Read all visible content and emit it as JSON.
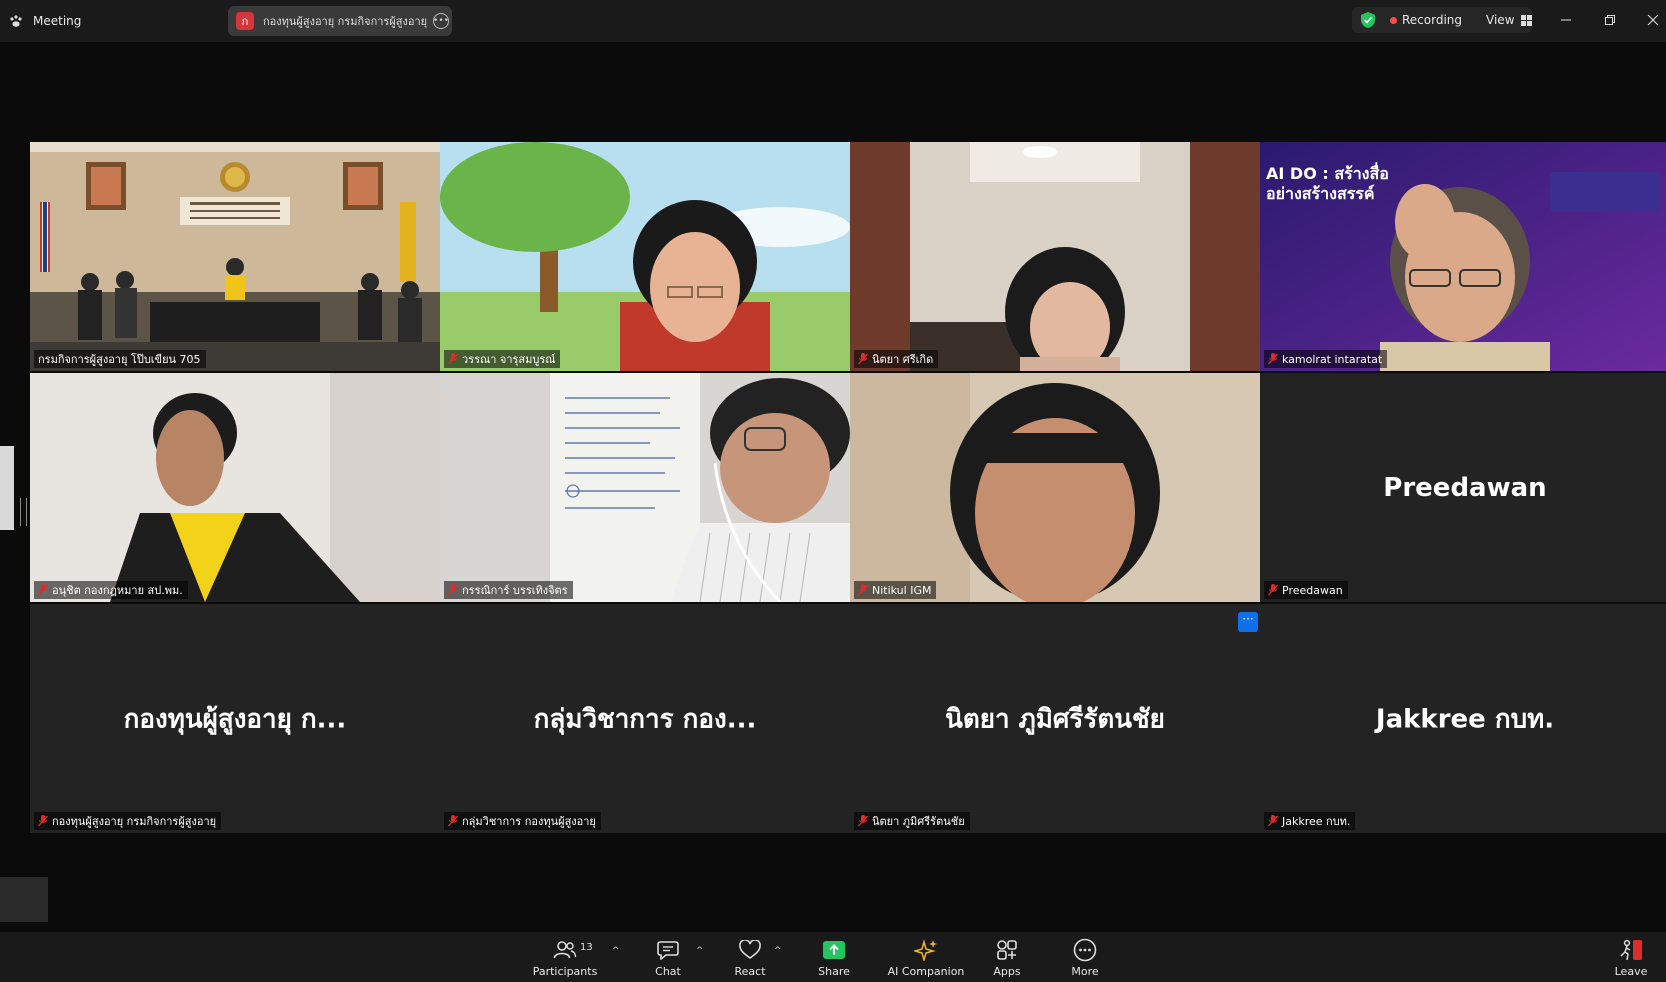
{
  "app": {
    "title": "Meeting",
    "share_pill": {
      "avatar_letter": "ก",
      "text": "กองทุนผู้สูงอายุ กรมกิจการผู้สูงอายุ's sc"
    },
    "status": {
      "recording_label": "Recording",
      "view_label": "View"
    }
  },
  "tiles": [
    {
      "name": "กรมกิจการผู้สูงอายุ โป๊บเขียน 705",
      "big_name": "",
      "muted": false,
      "active": true,
      "scene": "room"
    },
    {
      "name": "วรรณา จารุสมบูรณ์",
      "big_name": "",
      "muted": true,
      "scene": "woman-tree"
    },
    {
      "name": "นิตยา ศรีเกิด",
      "big_name": "",
      "muted": true,
      "scene": "woman-room"
    },
    {
      "name": "kamolrat intaratat",
      "big_name": "",
      "muted": true,
      "scene": "woman-banner",
      "banner": "AI DO : สร้างสื่อ อย่างสร้างสรรค์"
    },
    {
      "name": "อนุชิต กองกฎหมาย สป.พม.",
      "big_name": "",
      "muted": true,
      "scene": "man-yellow"
    },
    {
      "name": "กรรณิการ์ บรรเทิงจิตร",
      "big_name": "",
      "muted": true,
      "scene": "whiteboard"
    },
    {
      "name": "Nitikul IGM",
      "big_name": "",
      "muted": true,
      "scene": "woman-close"
    },
    {
      "name": "Preedawan",
      "big_name": "Preedawan",
      "muted": true
    },
    {
      "name": "กองทุนผู้สูงอายุ กรมกิจการผู้สูงอายุ",
      "big_name": "กองทุนผู้สูงอายุ ก...",
      "muted": true
    },
    {
      "name": "กลุ่มวิชาการ กองทุนผู้สูงอายุ",
      "big_name": "กลุ่มวิชาการ กอง...",
      "muted": true
    },
    {
      "name": "นิตยา ภูมิศรีรัตนชัย",
      "big_name": "นิตยา ภูมิศรีรัตนชัย",
      "muted": true
    },
    {
      "name": "Jakkree กบท.",
      "big_name": "Jakkree กบท.",
      "muted": true
    }
  ],
  "toolbar": {
    "participants_label": "Participants",
    "participants_count": "13",
    "chat_label": "Chat",
    "react_label": "React",
    "share_label": "Share",
    "ai_label": "AI Companion",
    "apps_label": "Apps",
    "more_label": "More",
    "leave_label": "Leave"
  },
  "colors": {
    "active_border": "#3fd18f",
    "share_green": "#23c55e",
    "leave_red": "#e02b2b",
    "accent_blue": "#0e71eb"
  }
}
